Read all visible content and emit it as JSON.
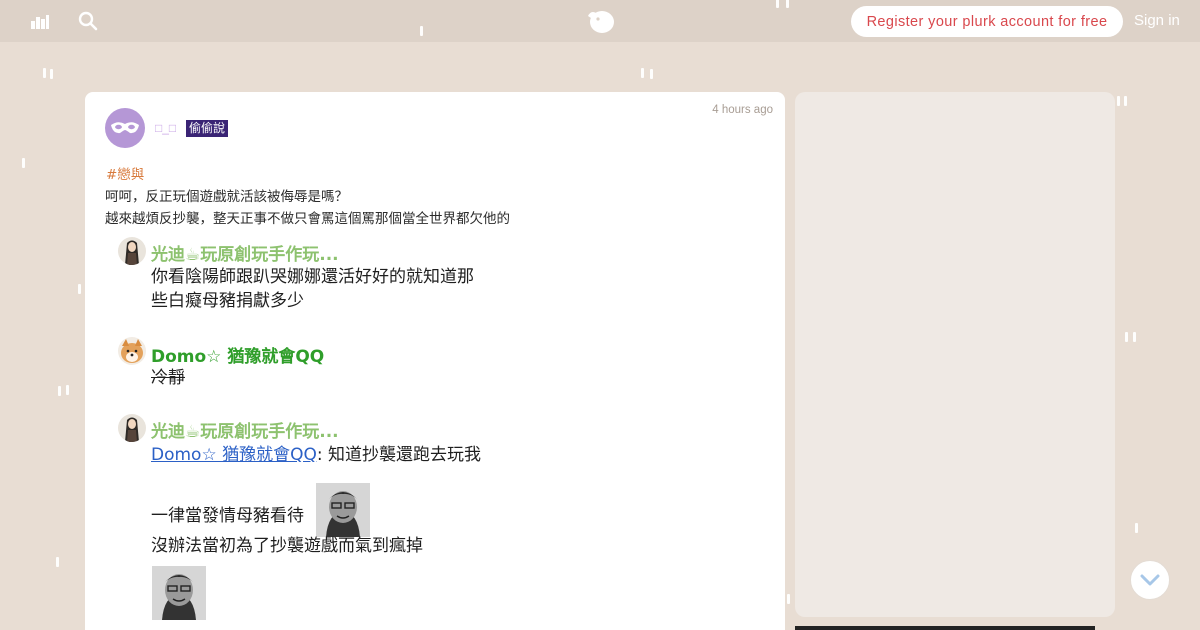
{
  "header": {
    "home_icon": "map-grid-icon",
    "search_icon": "search-icon",
    "logo_icon": "plurk-dino-logo",
    "register_label": "Register your plurk account for free",
    "signin_label": "Sign in",
    "colors": {
      "bar": "#ddd2c8",
      "register_text": "#d9484d"
    }
  },
  "post": {
    "author_name": "□_□",
    "author_badge": "偷偷說",
    "time": "4 hours ago",
    "hashtag": "#戀與",
    "lines": [
      "呵呵，反正玩個遊戲就活該被侮辱是嗎？",
      "越來越煩反抄襲，整天正事不做只會罵這個罵那個當全世界都欠他的"
    ]
  },
  "responses": [
    {
      "name": "光迪☕玩原創玩手作玩...",
      "lines": [
        "你看陰陽師跟趴哭娜娜還活好好的就知道那",
        "些白癡母豬捐獻多少"
      ]
    },
    {
      "name": "Domo☆ 猶豫就會QQ",
      "lines": [
        "冷靜"
      ]
    },
    {
      "name": "光迪☕玩原創玩手作玩...",
      "mention": "Domo☆ 猶豫就會QQ",
      "mention_suffix": ": 知道抄襲還跑去玩我",
      "line2": "一律當發情母豬看待",
      "line3": "沒辦法當初為了抄襲遊戲而氣到瘋掉"
    }
  ],
  "controls": {
    "scroll_down_icon": "chevron-down-icon"
  }
}
